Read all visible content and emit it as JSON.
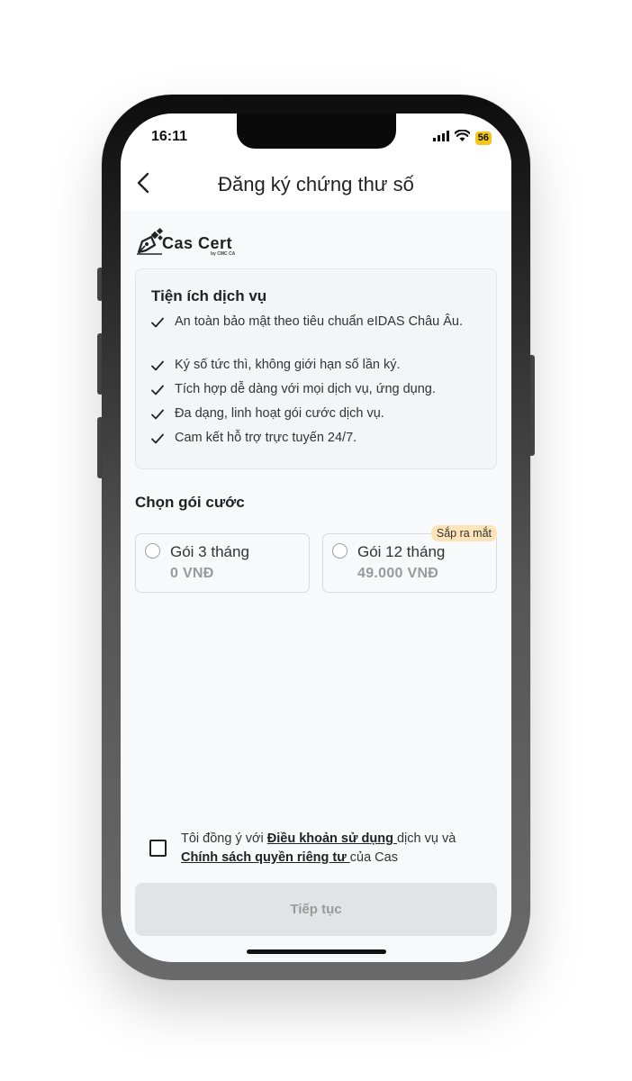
{
  "status_bar": {
    "time": "16:11",
    "battery": "56"
  },
  "header": {
    "title": "Đăng ký chứng thư số"
  },
  "brand": {
    "name": "Cas Cert",
    "sub": "by CMC CA"
  },
  "benefits": {
    "title": "Tiện ích dịch vụ",
    "items": [
      "An toàn bảo mật theo tiêu chuẩn eIDAS Châu Âu.",
      "Ký số tức thì, không giới hạn số lần ký.",
      "Tích hợp dễ dàng với mọi dịch vụ, ứng dụng.",
      "Đa dạng, linh hoạt gói cước dịch vụ.",
      "Cam kết hỗ trợ trực tuyến 24/7."
    ]
  },
  "plans": {
    "title": "Chọn gói cước",
    "items": [
      {
        "name": "Gói 3 tháng",
        "price": "0 VNĐ"
      },
      {
        "name": "Gói 12 tháng",
        "price": "49.000 VNĐ",
        "badge": "Sắp ra mắt"
      }
    ]
  },
  "agreement": {
    "prefix": "Tôi đồng ý với ",
    "terms_link": "Điều khoản sử dụng ",
    "middle": "dịch vụ và",
    "privacy_link": "Chính sách quyền riêng tư ",
    "suffix": "của Cas"
  },
  "continue_button": "Tiếp tục",
  "colors": {
    "badge_bg": "#fde4b8",
    "battery": "#f5c518",
    "disabled_button": "#e1e3e6"
  }
}
